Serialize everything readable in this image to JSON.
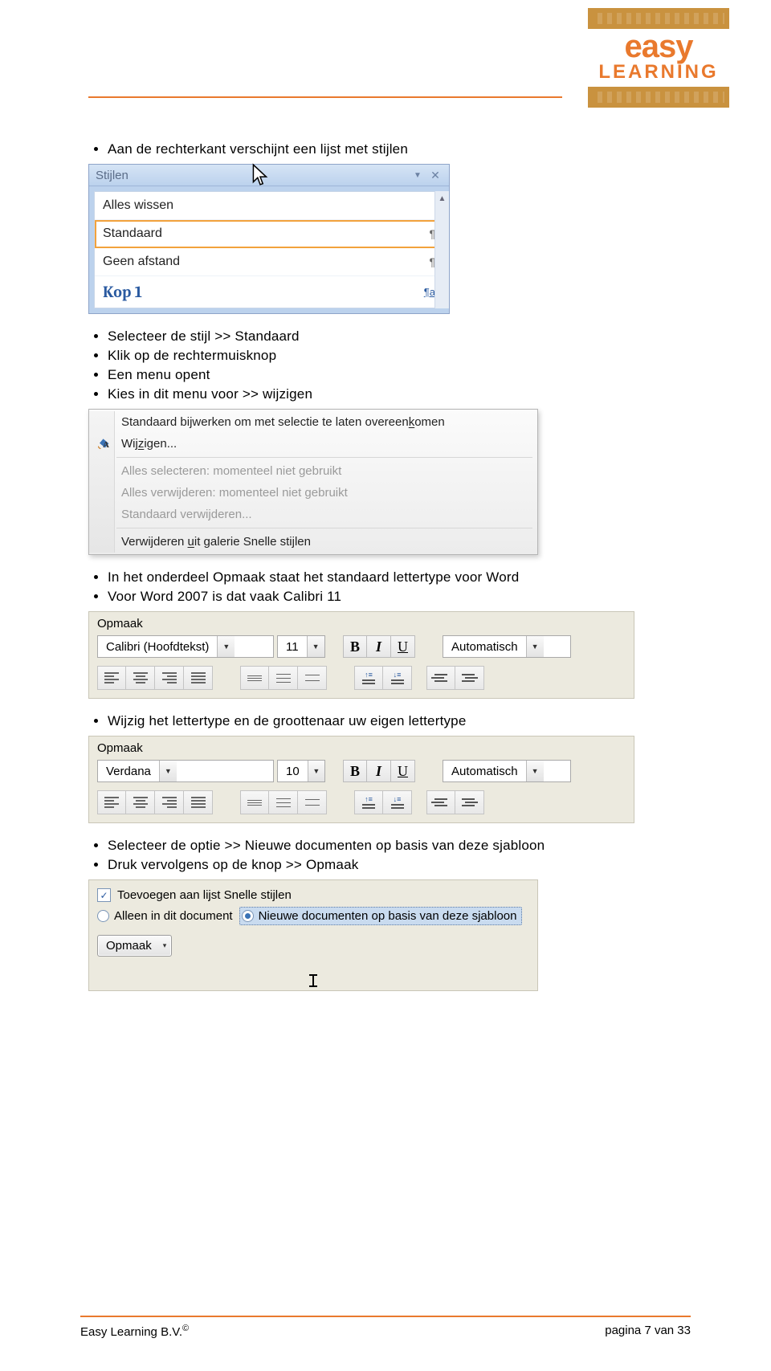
{
  "logo": {
    "line1": "easy",
    "line2": "LEARNING"
  },
  "intro_bullet": "Aan de rechterkant verschijnt een lijst met stijlen",
  "styles_pane": {
    "title": "Stijlen",
    "items": [
      {
        "label": "Alles wissen",
        "mark": ""
      },
      {
        "label": "Standaard",
        "mark": "¶",
        "selected": true
      },
      {
        "label": "Geen afstand",
        "mark": "¶"
      },
      {
        "label": "Kop 1",
        "mark": "¶a",
        "heading": true
      }
    ]
  },
  "mid_bullets": [
    "Selecteer de stijl >> Standaard",
    "Klik op de rechtermuisknop",
    "Een menu opent",
    "Kies in dit menu voor >> wijzigen"
  ],
  "context_menu": {
    "items": [
      {
        "label_pre": "Standaard bijwerken om met selectie te laten overeen",
        "label_key": "k",
        "label_post": "omen",
        "enabled": true
      },
      {
        "label_pre": "Wij",
        "label_key": "z",
        "label_post": "igen...",
        "enabled": true,
        "icon": "paint"
      },
      {
        "sep": true
      },
      {
        "label": "Alles selecteren: momenteel niet gebruikt",
        "enabled": false
      },
      {
        "label": "Alles verwijderen: momenteel niet gebruikt",
        "enabled": false
      },
      {
        "label": "Standaard verwijderen...",
        "enabled": false
      },
      {
        "sep": true
      },
      {
        "label_pre": "Verwijderen ",
        "label_key": "u",
        "label_post": "it galerie Snelle stijlen",
        "enabled": true
      }
    ]
  },
  "after_menu_bullets": [
    "In het onderdeel Opmaak staat het standaard lettertype voor Word",
    "Voor Word 2007 is dat vaak Calibri 11"
  ],
  "opmaak_a": {
    "section": "Opmaak",
    "font": "Calibri (Hoofdtekst)",
    "size": "11",
    "bold": "B",
    "italic": "I",
    "under": "U",
    "color": "Automatisch"
  },
  "change_bullet": "Wijzig het lettertype en de groottenaar uw eigen lettertype",
  "opmaak_b": {
    "section": "Opmaak",
    "font": "Verdana",
    "size": "10",
    "bold": "B",
    "italic": "I",
    "under": "U",
    "color": "Automatisch"
  },
  "final_bullets": [
    "Selecteer de optie >> Nieuwe documenten op basis van deze sjabloon",
    "Druk vervolgens op de knop >> Opmaak"
  ],
  "options": {
    "chk": "Toevoegen aan lijst Snelle stijlen",
    "radio1": "Alleen in dit document",
    "radio2": "Nieuwe documenten op basis van deze sjabloon",
    "button": "Opmaak"
  },
  "footer": {
    "left_name": "Easy Learning B.V.",
    "left_mark": "©",
    "right": "pagina 7 van 33"
  }
}
